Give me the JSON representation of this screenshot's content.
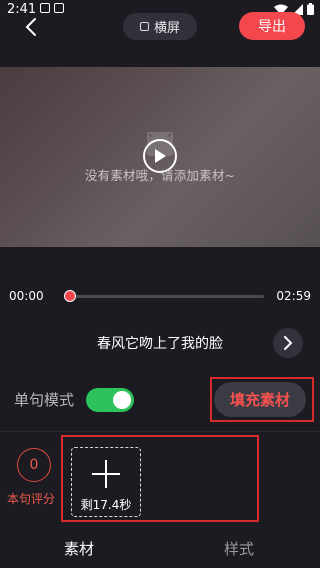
{
  "status_bar": {
    "time": "2:41"
  },
  "top_bar": {
    "landscape_label": "横屏",
    "export_label": "导出"
  },
  "preview": {
    "empty_hint": "没有素材哦，请添加素材~"
  },
  "timeline": {
    "current_time": "00:00",
    "total_time": "02:59",
    "progress": 0
  },
  "song": {
    "title": "春风它吻上了我的脸"
  },
  "mode": {
    "label": "单句模式",
    "enabled": true,
    "fill_button": "填充素材"
  },
  "score": {
    "value": "0",
    "label": "本句评分"
  },
  "material": {
    "remaining": "剩17.4秒"
  },
  "tabs": [
    {
      "label": "素材",
      "active": true
    },
    {
      "label": "样式",
      "active": false
    }
  ],
  "colors": {
    "accent": "#f2474d",
    "toggle_on": "#2ec25a",
    "background": "#1b1b21",
    "highlight_box": "#d42a2a"
  }
}
